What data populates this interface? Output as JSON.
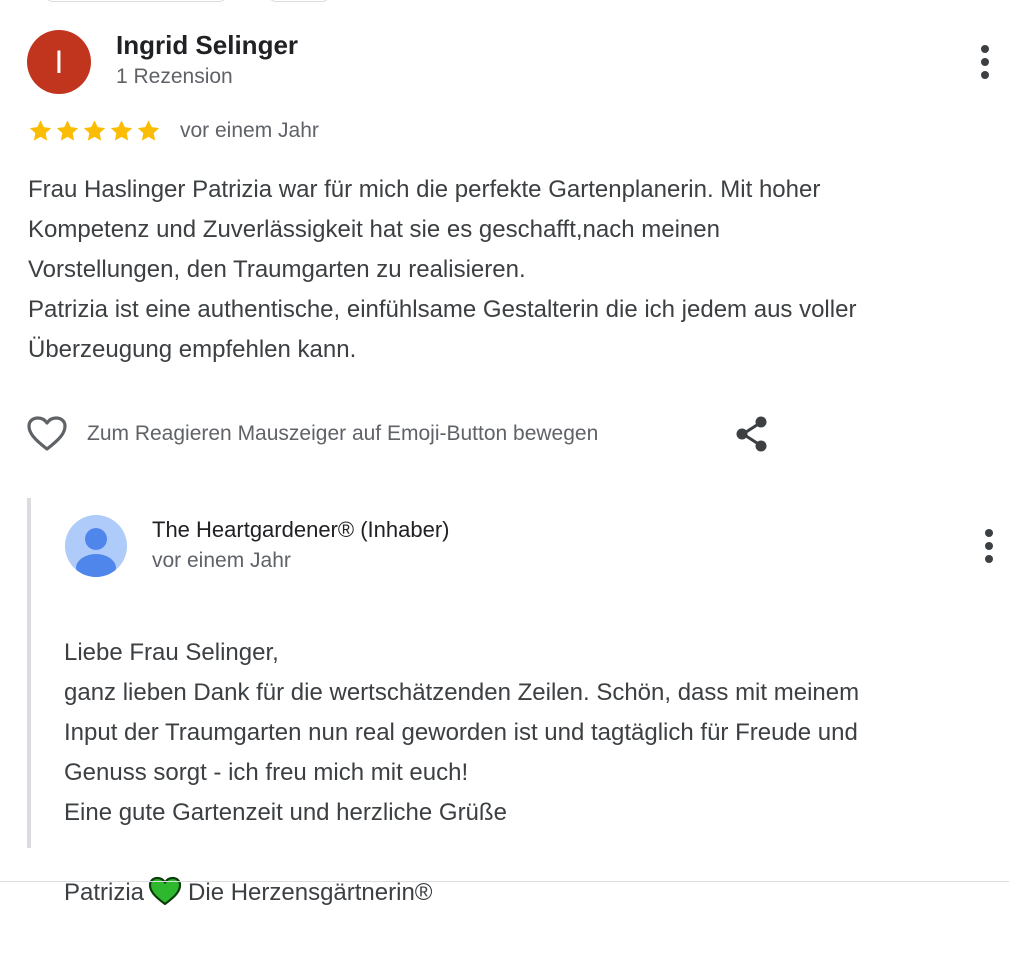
{
  "review": {
    "avatar_letter": "I",
    "reviewer_name": "Ingrid Selinger",
    "reviewer_meta": "1 Rezension",
    "rating": 5,
    "rating_max": 5,
    "date": "vor einem Jahr",
    "text_lines": [
      "Frau Haslinger Patrizia war für mich die perfekte Gartenplanerin. Mit hoher",
      "Kompetenz und Zuverlässigkeit hat sie es geschafft,nach meinen",
      "Vorstellungen, den Traumgarten zu realisieren.",
      "Patrizia ist eine authentische, einfühlsame Gestalterin die ich jedem aus voller",
      "Überzeugung empfehlen kann."
    ],
    "react_label": "Zum Reagieren Mauszeiger auf Emoji-Button bewegen",
    "icons": {
      "more": "more-vert-icon",
      "heart": "heart-outline-icon",
      "share": "share-icon",
      "star": "star-icon"
    }
  },
  "owner_reply": {
    "name": "The Heartgardener® (Inhaber)",
    "date": "vor einem Jahr",
    "text_lines": [
      "Liebe Frau Selinger,",
      "ganz lieben Dank für die wertschätzenden Zeilen. Schön, dass mit meinem",
      "Input der Traumgarten nun real geworden ist und tagtäglich für Freude und",
      "Genuss sorgt - ich freu mich mit euch!",
      "Eine gute Gartenzeit und herzliche Grüße"
    ],
    "signature_name": "Patrizia",
    "signature_title": "Die Herzensgärtnerin®",
    "icons": {
      "avatar": "default-avatar-icon",
      "more": "more-vert-icon",
      "heart": "green-heart-icon"
    }
  },
  "colors": {
    "avatar_bg": "#c1351e",
    "star": "#fbbc04",
    "muted_text": "#5f6368",
    "body_text": "#3c4043",
    "name_text": "#202124",
    "reply_border": "#dadce0",
    "owner_avatar_bg": "#aecbfa",
    "owner_avatar_fg": "#4f86ec",
    "green_heart": "#2eb82e"
  }
}
